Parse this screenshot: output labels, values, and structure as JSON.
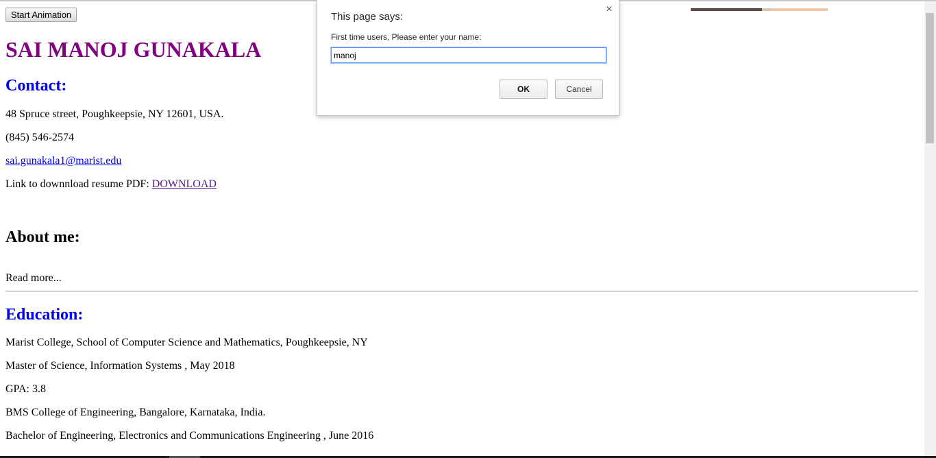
{
  "toolbar": {
    "start_animation_label": "Start Animation"
  },
  "header": {
    "name": "SAI MANOJ GUNAKALA"
  },
  "contact": {
    "heading": "Contact:",
    "address": "48 Spruce street, Poughkeepsie, NY 12601, USA.",
    "phone": "(845) 546-2574",
    "email": "sai.gunakala1@marist.edu",
    "resume_prefix": "Link to downnload resume PDF: ",
    "resume_link": "DOWNLOAD"
  },
  "about": {
    "heading": "About me:",
    "read_more": "Read more..."
  },
  "education": {
    "heading": "Education:",
    "lines": [
      "Marist College, School of Computer Science and Mathematics, Poughkeepsie, NY",
      "Master of Science, Information Systems , May 2018",
      "GPA: 3.8",
      "BMS College of Engineering, Bangalore, Karnataka, India.",
      "Bachelor of Engineering, Electronics and Communications Engineering , June 2016"
    ]
  },
  "dialog": {
    "title": "This page says:",
    "close_icon": "close-icon",
    "message": "First time users, Please enter your name:",
    "input_value": "manoj",
    "ok_label": "OK",
    "cancel_label": "Cancel"
  },
  "colors": {
    "name": "#800080",
    "heading_blue": "#0000ee",
    "link_visited": "#551a8b",
    "input_focus": "#4d90fe"
  }
}
